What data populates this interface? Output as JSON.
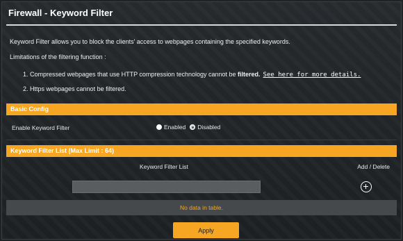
{
  "page": {
    "title": "Firewall - Keyword Filter",
    "description": "Keyword Filter allows you to block the clients' access to webpages containing the specified keywords.",
    "limitations_title": "Limitations of the filtering function :",
    "limitations": [
      {
        "text_prefix": "1. Compressed webpages that use HTTP compression technology cannot be ",
        "text_strong": "filtered.",
        "link": "See here for more details."
      },
      {
        "text": "2. Https webpages cannot be filtered."
      }
    ]
  },
  "basic_config": {
    "header": "Basic Config",
    "enable_label": "Enable Keyword Filter",
    "options": [
      {
        "label": "Enabled",
        "selected": true
      },
      {
        "label": "Disabled",
        "selected": false
      }
    ]
  },
  "keyword_list": {
    "header": "Keyword Filter List (Max Limit : 64)",
    "columns": [
      "Keyword Filter List",
      "Add / Delete"
    ],
    "input_value": "",
    "empty_text": "No data in table."
  },
  "actions": {
    "apply_label": "Apply"
  },
  "colors": {
    "accent": "#f6a623",
    "background": "#1f2326",
    "input": "#595d60"
  },
  "icons": {
    "add": "plus-circle-icon"
  }
}
